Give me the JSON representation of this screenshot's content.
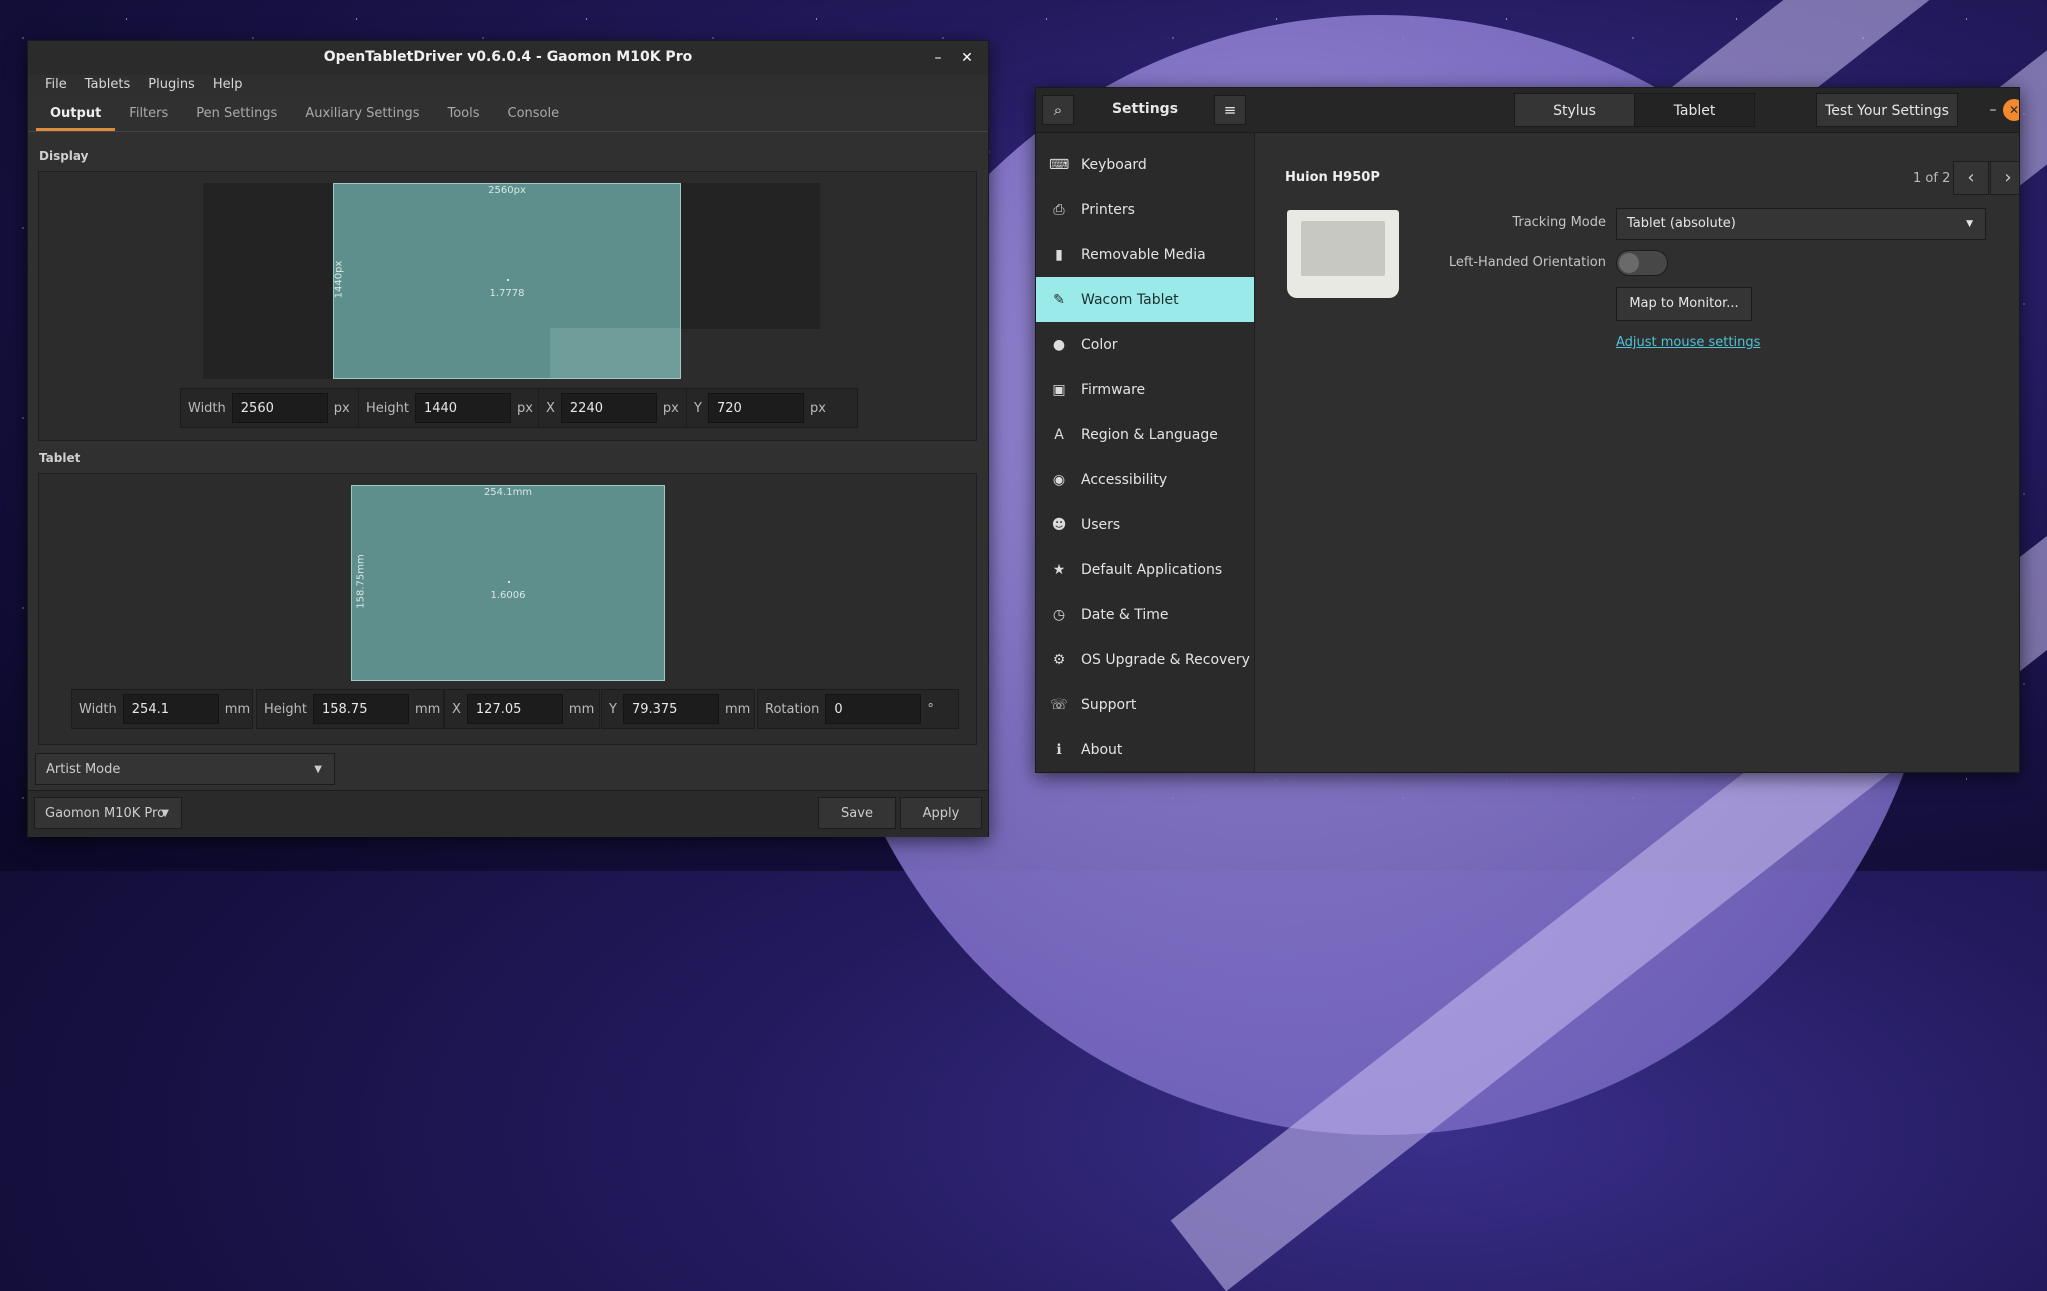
{
  "otd": {
    "title": "OpenTabletDriver v0.6.0.4 - Gaomon M10K Pro",
    "menu": [
      "File",
      "Tablets",
      "Plugins",
      "Help"
    ],
    "tabs": [
      "Output",
      "Filters",
      "Pen Settings",
      "Auxiliary Settings",
      "Tools",
      "Console"
    ],
    "display": {
      "section_label": "Display",
      "width_label": "2560px",
      "height_label": "1440px",
      "ratio": "1.7778",
      "fields": [
        {
          "label": "Width",
          "value": "2560",
          "unit": "px"
        },
        {
          "label": "Height",
          "value": "1440",
          "unit": "px"
        },
        {
          "label": "X",
          "value": "2240",
          "unit": "px"
        },
        {
          "label": "Y",
          "value": "720",
          "unit": "px"
        }
      ]
    },
    "tablet": {
      "section_label": "Tablet",
      "width_label": "254.1mm",
      "height_label": "158.75mm",
      "ratio": "1.6006",
      "fields": [
        {
          "label": "Width",
          "value": "254.1",
          "unit": "mm"
        },
        {
          "label": "Height",
          "value": "158.75",
          "unit": "mm"
        },
        {
          "label": "X",
          "value": "127.05",
          "unit": "mm"
        },
        {
          "label": "Y",
          "value": "79.375",
          "unit": "mm"
        },
        {
          "label": "Rotation",
          "value": "0",
          "unit": "°"
        }
      ]
    },
    "mode_dropdown": "Artist Mode",
    "tablet_dropdown": "Gaomon M10K Pro",
    "save_label": "Save",
    "apply_label": "Apply",
    "colors": {
      "accent": "#e08a3c",
      "area_fill": "#5e8f8c"
    }
  },
  "settings": {
    "title": "Settings",
    "segments": [
      "Stylus",
      "Tablet"
    ],
    "test_button": "Test Your Settings",
    "sidebar": [
      {
        "label": "Keyboard",
        "icon": "keyboard-icon",
        "glyph": "⌨"
      },
      {
        "label": "Printers",
        "icon": "printer-icon",
        "glyph": "⎙"
      },
      {
        "label": "Removable Media",
        "icon": "usb-icon",
        "glyph": "▮"
      },
      {
        "label": "Wacom Tablet",
        "icon": "tablet-pen-icon",
        "glyph": "✎"
      },
      {
        "label": "Color",
        "icon": "color-icon",
        "glyph": "●"
      },
      {
        "label": "Firmware",
        "icon": "firmware-icon",
        "glyph": "▣"
      },
      {
        "label": "Region & Language",
        "icon": "language-icon",
        "glyph": "A"
      },
      {
        "label": "Accessibility",
        "icon": "accessibility-icon",
        "glyph": "◉"
      },
      {
        "label": "Users",
        "icon": "users-icon",
        "glyph": "☻"
      },
      {
        "label": "Default Applications",
        "icon": "star-icon",
        "glyph": "★"
      },
      {
        "label": "Date & Time",
        "icon": "clock-icon",
        "glyph": "◷"
      },
      {
        "label": "OS Upgrade & Recovery",
        "icon": "upgrade-icon",
        "glyph": "⚙"
      },
      {
        "label": "Support",
        "icon": "support-icon",
        "glyph": "☏"
      },
      {
        "label": "About",
        "icon": "info-icon",
        "glyph": "ℹ"
      }
    ],
    "device_name": "Huion H950P",
    "pager": "1 of 2",
    "tracking_mode_label": "Tracking Mode",
    "tracking_mode_value": "Tablet (absolute)",
    "left_handed_label": "Left-Handed Orientation",
    "left_handed_on": false,
    "map_button": "Map to Monitor...",
    "mouse_link": "Adjust mouse settings",
    "colors": {
      "sidebar_active": "#9aeaea",
      "close": "#f08a2c",
      "link": "#4fc3d8"
    }
  }
}
